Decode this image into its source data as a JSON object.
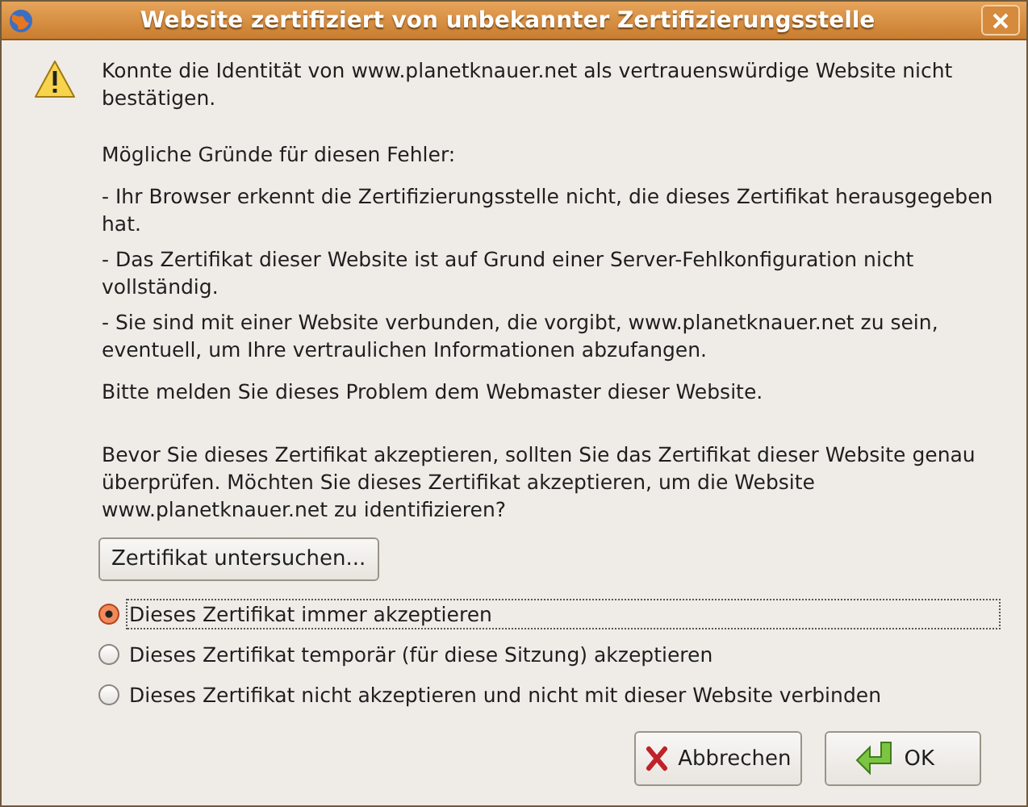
{
  "window": {
    "title": "Website zertifiziert von unbekannter Zertifizierungsstelle"
  },
  "message": "Konnte die Identität von www.planetknauer.net als vertrauenswürdige Website nicht bestätigen.",
  "details": [
    {
      "kind": "text",
      "text": "Mögliche Gründe für diesen Fehler:"
    },
    {
      "kind": "text",
      "text": "- Ihr Browser erkennt die Zertifizierungsstelle nicht, die dieses Zertifikat herausgegeben hat."
    },
    {
      "kind": "text",
      "text": "- Das Zertifikat dieser Website ist auf Grund einer Server-Fehlkonfiguration nicht vollständig."
    },
    {
      "kind": "text",
      "text": "- Sie sind mit einer Website verbunden, die vorgibt, www.planetknauer.net zu sein, eventuell, um Ihre vertraulichen Informationen abzufangen."
    },
    {
      "kind": "text",
      "text": "Bitte melden Sie dieses Problem dem Webmaster dieser Website."
    },
    {
      "kind": "text",
      "text": "Bevor Sie dieses Zertifikat akzeptieren, sollten Sie das Zertifikat dieser Website genau überprüfen. Möchten Sie dieses Zertifikat akzeptieren, um die Website www.planetknauer.net zu identifizieren?"
    }
  ],
  "examine_button": "Zertifikat untersuchen...",
  "options": [
    {
      "label": "Dieses Zertifikat immer akzeptieren",
      "selected": true
    },
    {
      "label": "Dieses Zertifikat temporär (für diese Sitzung) akzeptieren",
      "selected": false
    },
    {
      "label": "Dieses Zertifikat nicht akzeptieren und nicht mit dieser Website verbinden",
      "selected": false
    }
  ],
  "buttons": [
    {
      "kind": "cancel",
      "label": "Abbrechen"
    },
    {
      "kind": "ok",
      "label": "OK"
    }
  ]
}
